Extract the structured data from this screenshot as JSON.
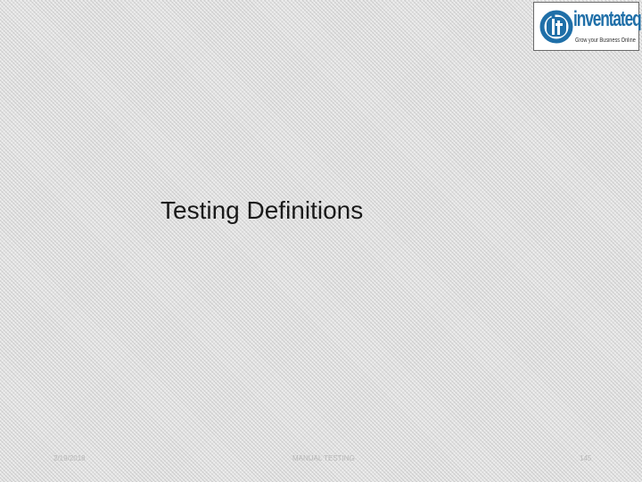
{
  "slide": {
    "title": "Testing Definitions",
    "logo": {
      "wordmark": "inventateq",
      "tagline": "Grow your Business Online",
      "brand_color": "#1f6fa8",
      "icon": "it-monogram-icon"
    },
    "footer": {
      "date": "2/19/2018",
      "center_text": "MANUAL TESTING",
      "page_number": "145"
    }
  }
}
